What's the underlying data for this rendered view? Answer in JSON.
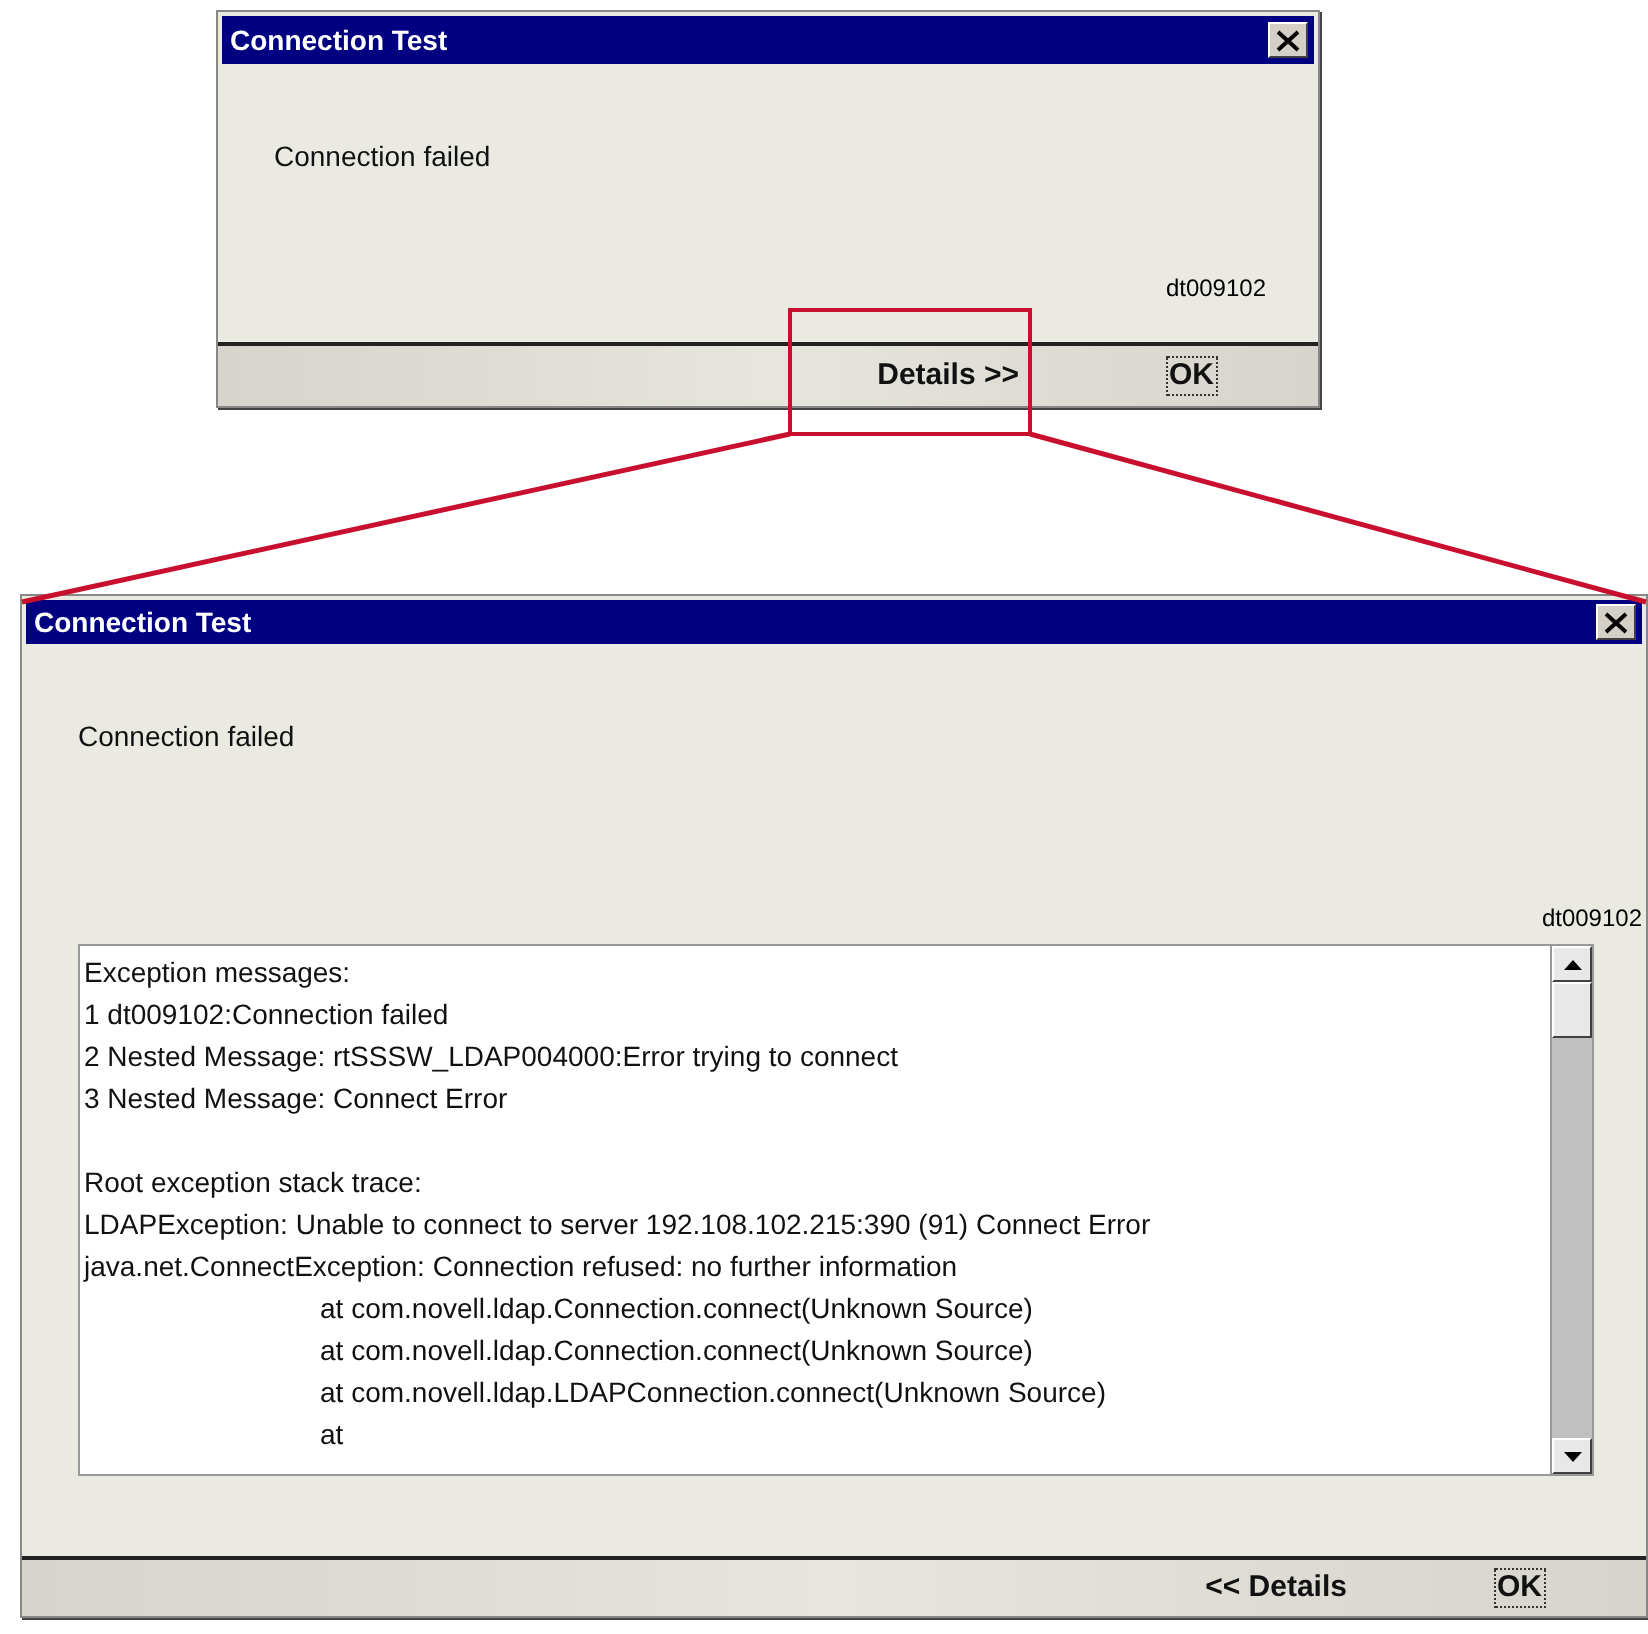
{
  "dialogs": [
    {
      "title": "Connection Test",
      "message": "Connection failed",
      "code": "dt009102",
      "buttons": [
        {
          "label": "Details >>",
          "kind": "toggle"
        },
        {
          "label": "OK",
          "kind": "default"
        }
      ]
    },
    {
      "title": "Connection Test",
      "message": "Connection failed",
      "code": "dt009102",
      "details": [
        {
          "text": "Exception messages:",
          "kind": "message"
        },
        {
          "text": "1 dt009102:Connection failed",
          "kind": "message"
        },
        {
          "text": "2 Nested Message: rtSSSW_LDAP004000:Error trying to connect",
          "kind": "message"
        },
        {
          "text": "3 Nested Message: Connect Error",
          "kind": "message"
        },
        {
          "text": "Root exception stack trace:",
          "kind": "heading"
        },
        {
          "text": "LDAPException: Unable to connect to server 192.108.102.215:390 (91) Connect Error",
          "kind": "message"
        },
        {
          "text": "java.net.ConnectException: Connection refused: no further information",
          "kind": "message"
        },
        {
          "text": "at com.novell.ldap.Connection.connect(Unknown Source)",
          "kind": "frame"
        },
        {
          "text": "at com.novell.ldap.Connection.connect(Unknown Source)",
          "kind": "frame"
        },
        {
          "text": "at com.novell.ldap.LDAPConnection.connect(Unknown Source)",
          "kind": "frame"
        },
        {
          "text": "at",
          "kind": "frame"
        }
      ],
      "buttons": [
        {
          "label": "<< Details",
          "kind": "toggle"
        },
        {
          "label": "OK",
          "kind": "default"
        }
      ]
    }
  ]
}
